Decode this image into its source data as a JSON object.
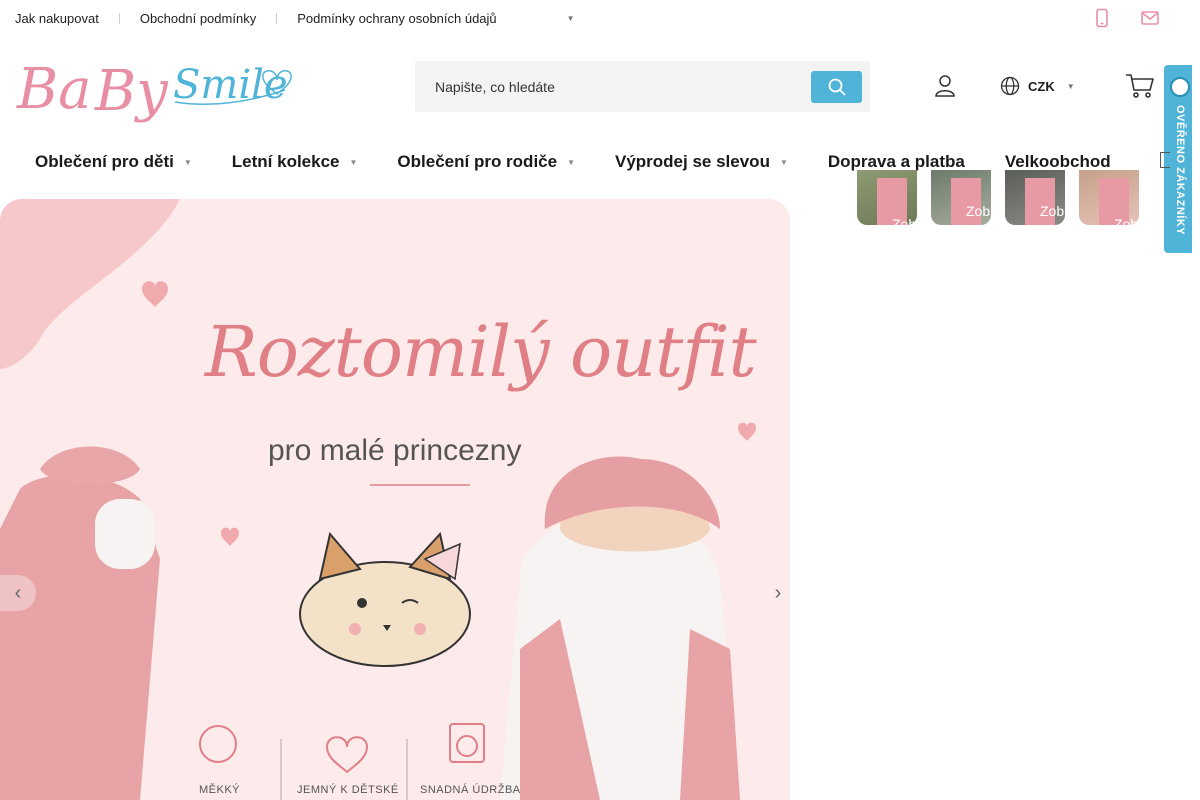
{
  "topbar": {
    "links": [
      "Jak nakupovat",
      "Obchodní podmínky",
      "Podmínky ochrany osobních údajů"
    ],
    "more_icon": "caret-icon",
    "icons": [
      "phone-icon",
      "mail-icon"
    ]
  },
  "header": {
    "logo_text": "BaBy Smile",
    "search_placeholder": "Napište, co hledáte",
    "currency": "CZK"
  },
  "nav": {
    "items": [
      {
        "label": "Oblečení pro děti",
        "has_dropdown": true
      },
      {
        "label": "Letní kolekce",
        "has_dropdown": true
      },
      {
        "label": "Oblečení pro rodiče",
        "has_dropdown": true
      },
      {
        "label": "Výprodej se slevou",
        "has_dropdown": true
      },
      {
        "label": "Doprava a platba",
        "has_dropdown": false
      },
      {
        "label": "Velkoobchod",
        "has_dropdown": false
      }
    ]
  },
  "badge": {
    "text": "OVĚŘENO ZÁKAZNÍKY"
  },
  "hero": {
    "title": "Roztomilý outfit",
    "subtitle": "pro malé princezny",
    "features": [
      "MĚKKÝ",
      "JEMNÝ K DĚTSKÉ",
      "SNADNÁ ÚDRŽBA"
    ]
  },
  "thumbnails": [
    {
      "label": "Zob"
    },
    {
      "label": "Zob"
    },
    {
      "label": "Zob"
    },
    {
      "label": "Zob"
    }
  ],
  "colors": {
    "accent": "#4fb4d8",
    "logo_pink": "#e88fa5",
    "logo_blue": "#4fb4d8",
    "hero_bg": "#fbe2e2",
    "hero_title": "#e07f86"
  }
}
